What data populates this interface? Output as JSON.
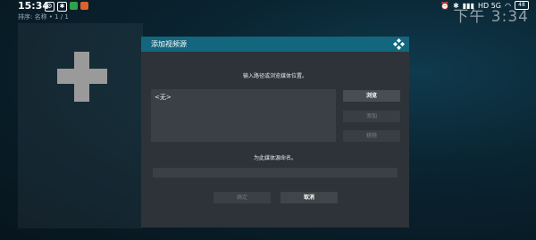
{
  "statusbar": {
    "time": "15:34",
    "left_icons": [
      "settings-icon",
      "shield-icon",
      "app-icon-green",
      "app-icon-orange"
    ],
    "right_text": "HD 5G",
    "battery": "48"
  },
  "background_clock": "下午 3:34",
  "sort_line": "排序: 名称  •  1 / 1",
  "dialog": {
    "title": "添加视频源",
    "path_prompt": "输入路径或浏览媒体位置。",
    "path_items": [
      "<无>"
    ],
    "buttons": {
      "browse": "浏览",
      "add": "添加",
      "remove": "移除",
      "ok": "确定",
      "cancel": "取消"
    },
    "name_prompt": "为此媒体源命名。",
    "name_value": ""
  },
  "colors": {
    "header": "#12667e",
    "dialog_bg": "#2d3338",
    "add_tile": "#9a9a9a"
  }
}
